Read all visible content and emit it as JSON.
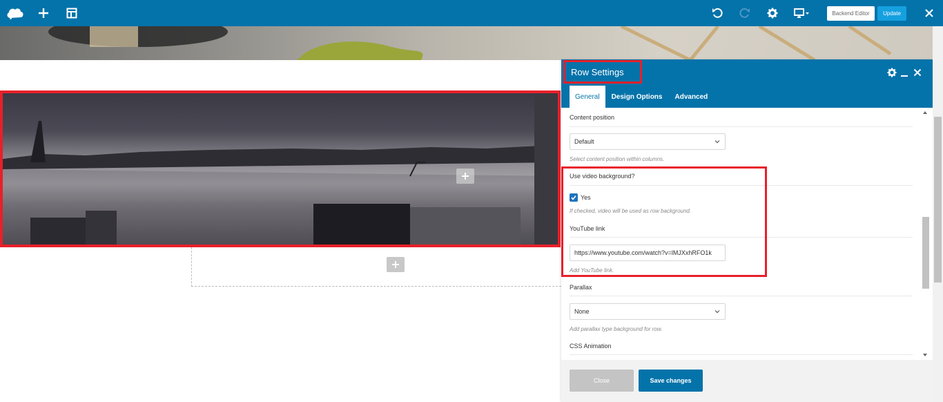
{
  "toolbar": {
    "logo_icon": "cloud-logo-icon",
    "add_icon": "plus-icon",
    "templates_icon": "layout-icon",
    "undo_icon": "undo-icon",
    "redo_icon": "redo-icon",
    "settings_icon": "gear-icon",
    "responsive_icon": "monitor-dropdown-icon",
    "backend_editor_label": "Backend Editor",
    "update_label": "Update",
    "close_icon": "close-icon"
  },
  "row_settings": {
    "title": "Row Settings",
    "tabs": [
      {
        "label": "General",
        "active": true
      },
      {
        "label": "Design Options",
        "active": false
      },
      {
        "label": "Advanced",
        "active": false
      }
    ],
    "fields": {
      "content_position": {
        "label": "Content position",
        "value": "Default",
        "help": "Select content position within columns."
      },
      "video_background": {
        "label": "Use video background?",
        "checkbox_label": "Yes",
        "checked": true,
        "help": "If checked, video will be used as row background."
      },
      "youtube_link": {
        "label": "YouTube link",
        "value": "https://www.youtube.com/watch?v=lMJXxhRFO1k",
        "help": "Add YouTube link."
      },
      "parallax": {
        "label": "Parallax",
        "value": "None",
        "help": "Add parallax type background for row."
      },
      "css_animation": {
        "label": "CSS Animation"
      }
    },
    "footer": {
      "close_label": "Close",
      "save_label": "Save changes"
    }
  },
  "colors": {
    "brand": "#0473aa",
    "highlight": "#e8202a",
    "update_button": "#15a0e0"
  }
}
